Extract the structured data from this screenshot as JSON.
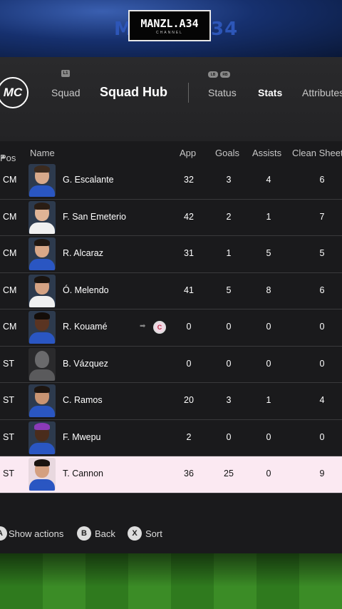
{
  "watermark": {
    "logo_text": "MANZL.A34",
    "logo_sub": "CHANNEL",
    "bg_left": "M",
    "bg_right": "34"
  },
  "header": {
    "logo_text": "MC",
    "badge_left": "L1",
    "badge_right": [
      "LB",
      "RB"
    ],
    "tabs": {
      "squad": "Squad",
      "squad_hub": "Squad Hub",
      "status": "Status",
      "stats": "Stats",
      "attributes": "Attributes"
    }
  },
  "columns": {
    "pos": "Pos",
    "name": "Name",
    "app": "App",
    "goals": "Goals",
    "assists": "Assists",
    "clean_sheets": "Clean Sheets"
  },
  "rows": [
    {
      "pos": "CM",
      "name": "G. Escalante",
      "app": "32",
      "goals": "3",
      "assists": "4",
      "clean": "6"
    },
    {
      "pos": "CM",
      "name": "F. San Emeterio",
      "app": "42",
      "goals": "2",
      "assists": "1",
      "clean": "7"
    },
    {
      "pos": "CM",
      "name": "R. Alcaraz",
      "app": "31",
      "goals": "1",
      "assists": "5",
      "clean": "5"
    },
    {
      "pos": "CM",
      "name": "Ó. Melendo",
      "app": "41",
      "goals": "5",
      "assists": "8",
      "clean": "6"
    },
    {
      "pos": "CM",
      "name": "R. Kouamé",
      "app": "0",
      "goals": "0",
      "assists": "0",
      "clean": "0",
      "badge": "C"
    },
    {
      "pos": "ST",
      "name": "B. Vázquez",
      "app": "0",
      "goals": "0",
      "assists": "0",
      "clean": "0"
    },
    {
      "pos": "ST",
      "name": "C. Ramos",
      "app": "20",
      "goals": "3",
      "assists": "1",
      "clean": "4"
    },
    {
      "pos": "ST",
      "name": "F. Mwepu",
      "app": "2",
      "goals": "0",
      "assists": "0",
      "clean": "0"
    },
    {
      "pos": "ST",
      "name": "T. Cannon",
      "app": "36",
      "goals": "25",
      "assists": "0",
      "clean": "9"
    }
  ],
  "footer": {
    "show_actions_key": "A",
    "show_actions": "Show actions",
    "back_key": "B",
    "back": "Back",
    "sort_key": "X",
    "sort": "Sort"
  },
  "colors": {
    "highlight_row": "#fbe9f2",
    "panel": "#1a1a1c"
  }
}
